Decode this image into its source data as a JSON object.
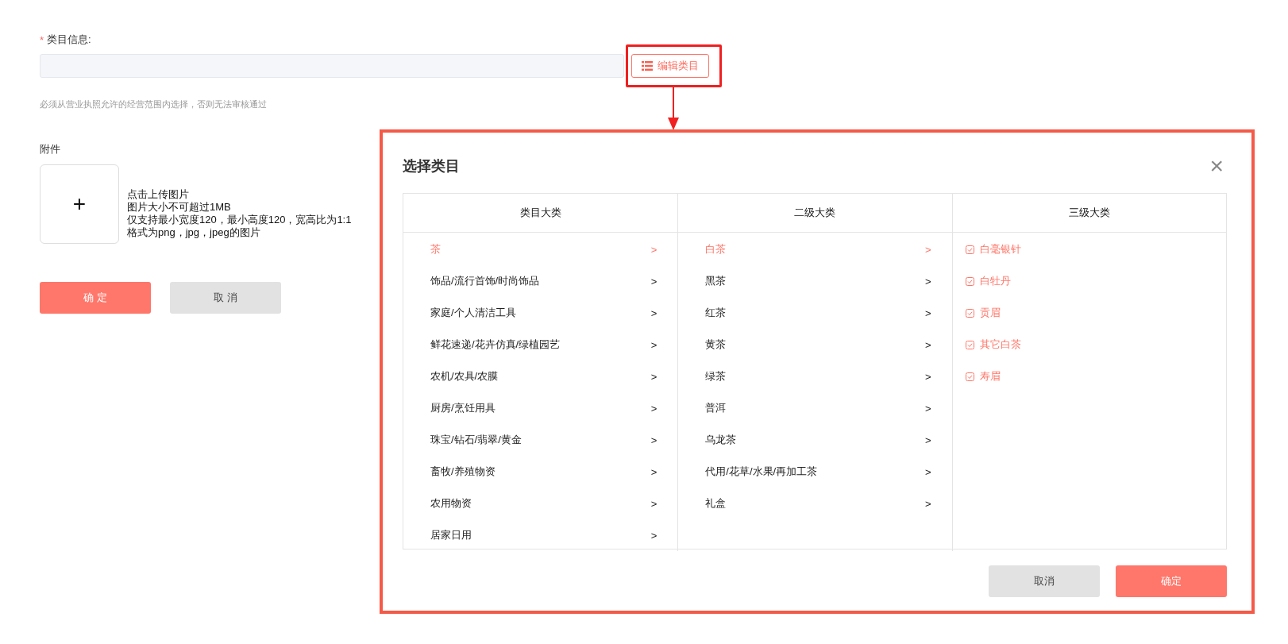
{
  "form": {
    "required_mark": "*",
    "category_label": "类目信息:",
    "edit_button": "编辑类目",
    "category_hint": "必须从营业执照允许的经营范围内选择，否则无法审核通过",
    "attachment_label": "附件",
    "upload_plus": "+",
    "upload_tips": [
      "点击上传图片",
      "图片大小不可超过1MB",
      "仅支持最小宽度120，最小高度120，宽高比为1:1",
      "格式为png，jpg，jpeg的图片"
    ],
    "confirm_button": "确 定",
    "cancel_button": "取 消"
  },
  "dialog": {
    "title": "选择类目",
    "close": "×",
    "columns": [
      {
        "header": "类目大类",
        "kind": "nav",
        "items": [
          {
            "label": "茶",
            "arrow": ">",
            "selected": true
          },
          {
            "label": "饰品/流行首饰/时尚饰品",
            "arrow": ">",
            "selected": false
          },
          {
            "label": "家庭/个人清洁工具",
            "arrow": ">",
            "selected": false
          },
          {
            "label": "鲜花速递/花卉仿真/绿植园艺",
            "arrow": ">",
            "selected": false
          },
          {
            "label": "农机/农具/农膜",
            "arrow": ">",
            "selected": false
          },
          {
            "label": "厨房/烹饪用具",
            "arrow": ">",
            "selected": false
          },
          {
            "label": "珠宝/钻石/翡翠/黄金",
            "arrow": ">",
            "selected": false
          },
          {
            "label": "畜牧/养殖物资",
            "arrow": ">",
            "selected": false
          },
          {
            "label": "农用物资",
            "arrow": ">",
            "selected": false
          },
          {
            "label": "居家日用",
            "arrow": ">",
            "selected": false
          }
        ]
      },
      {
        "header": "二级大类",
        "kind": "nav",
        "items": [
          {
            "label": "白茶",
            "arrow": ">",
            "selected": true
          },
          {
            "label": "黑茶",
            "arrow": ">",
            "selected": false
          },
          {
            "label": "红茶",
            "arrow": ">",
            "selected": false
          },
          {
            "label": "黄茶",
            "arrow": ">",
            "selected": false
          },
          {
            "label": "绿茶",
            "arrow": ">",
            "selected": false
          },
          {
            "label": "普洱",
            "arrow": ">",
            "selected": false
          },
          {
            "label": "乌龙茶",
            "arrow": ">",
            "selected": false
          },
          {
            "label": "代用/花草/水果/再加工茶",
            "arrow": ">",
            "selected": false
          },
          {
            "label": "礼盒",
            "arrow": ">",
            "selected": false
          }
        ]
      },
      {
        "header": "三级大类",
        "kind": "check",
        "items": [
          {
            "label": "白毫银针",
            "checked": true
          },
          {
            "label": "白牡丹",
            "checked": true
          },
          {
            "label": "贡眉",
            "checked": true
          },
          {
            "label": "其它白茶",
            "checked": true
          },
          {
            "label": "寿眉",
            "checked": true
          }
        ]
      }
    ],
    "cancel_button": "取消",
    "confirm_button": "确定"
  }
}
